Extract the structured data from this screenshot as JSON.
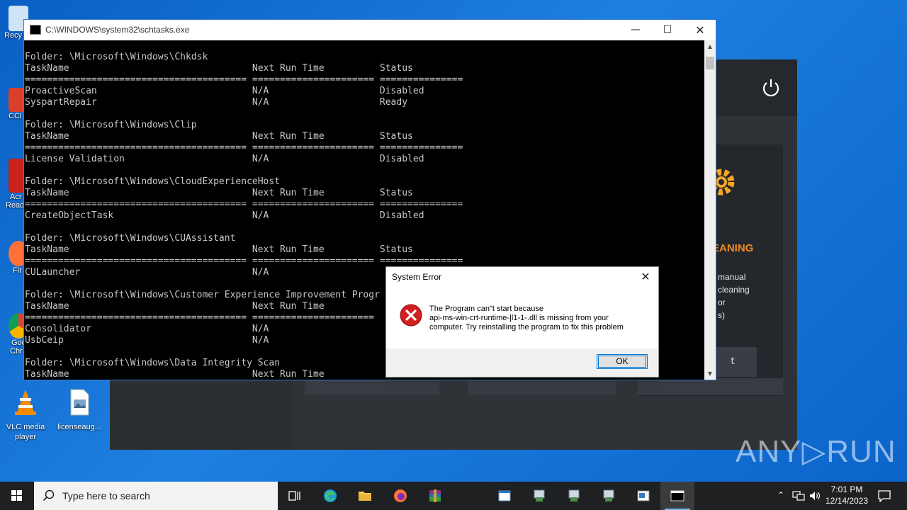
{
  "desktop": {
    "icons": [
      {
        "label": "VLC media player"
      },
      {
        "label": "licenseaug..."
      }
    ],
    "partial_labels": [
      "Recy",
      "CCl",
      "Acr",
      "Read",
      "Fir",
      "Goo",
      "Chr"
    ]
  },
  "background_app": {
    "panel_title": "EANING",
    "panel_lines": [
      "manual",
      "cleaning",
      "or",
      "s)"
    ],
    "button_label": "t",
    "accent_color": "#f08a22"
  },
  "console": {
    "title": "C:\\WINDOWS\\system32\\schtasks.exe",
    "lines": [
      "Folder: \\Microsoft\\Windows\\Chkdsk",
      "TaskName                                 Next Run Time          Status",
      "======================================== ====================== ===============",
      "ProactiveScan                            N/A                    Disabled",
      "SyspartRepair                            N/A                    Ready",
      "",
      "Folder: \\Microsoft\\Windows\\Clip",
      "TaskName                                 Next Run Time          Status",
      "======================================== ====================== ===============",
      "License Validation                       N/A                    Disabled",
      "",
      "Folder: \\Microsoft\\Windows\\CloudExperienceHost",
      "TaskName                                 Next Run Time          Status",
      "======================================== ====================== ===============",
      "CreateObjectTask                         N/A                    Disabled",
      "",
      "Folder: \\Microsoft\\Windows\\CUAssistant",
      "TaskName                                 Next Run Time          Status",
      "======================================== ====================== ===============",
      "CULauncher                               N/A",
      "",
      "Folder: \\Microsoft\\Windows\\Customer Experience Improvement Progr",
      "TaskName                                 Next Run Time",
      "======================================== ======================",
      "Consolidator                             N/A",
      "UsbCeip                                  N/A",
      "",
      "Folder: \\Microsoft\\Windows\\Data Integrity Scan",
      "TaskName                                 Next Run Time"
    ]
  },
  "dialog": {
    "title": "System Error",
    "message_lines": [
      "The Program can\"t start because",
      "api-ms-win-crt-runtime-|l1-1-.dll is missing from your",
      "computer. Try reinstalling the program to fix this problem"
    ],
    "ok_label": "OK"
  },
  "watermark": "ANY▷RUN",
  "taskbar": {
    "search_placeholder": "Type here to search",
    "time": "7:01 PM",
    "date": "12/14/2023"
  }
}
